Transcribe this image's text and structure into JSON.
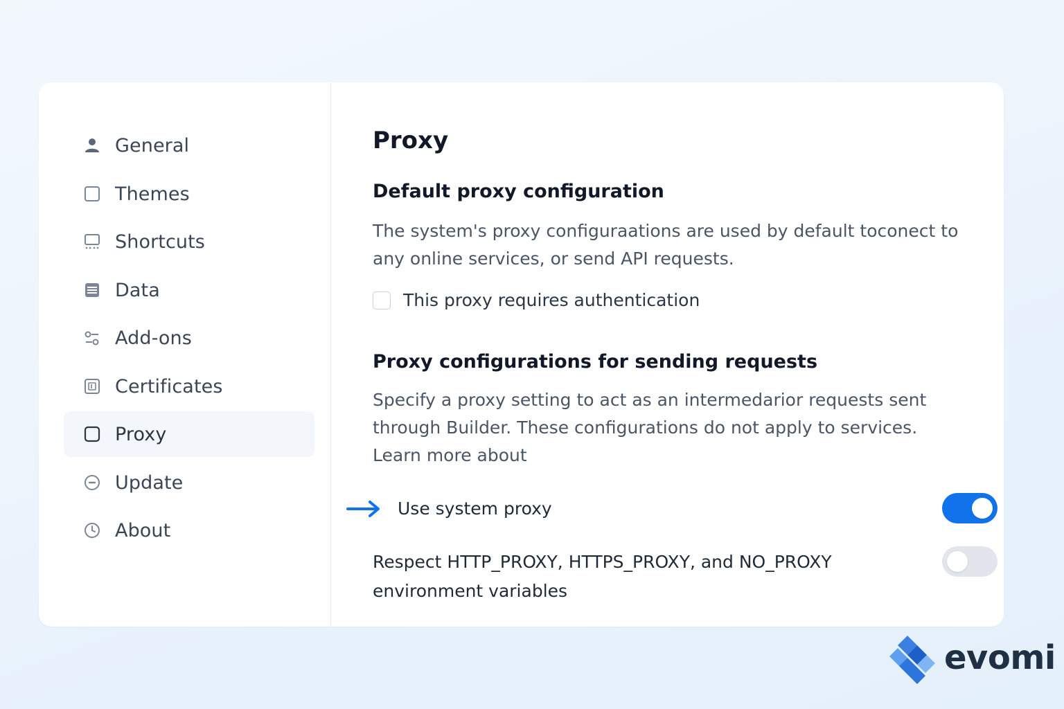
{
  "sidebar": {
    "items": [
      {
        "label": "General",
        "icon": "person-icon",
        "active": false
      },
      {
        "label": "Themes",
        "icon": "square-icon",
        "active": false
      },
      {
        "label": "Shortcuts",
        "icon": "keyboard-icon",
        "active": false
      },
      {
        "label": "Data",
        "icon": "database-icon",
        "active": false
      },
      {
        "label": "Add-ons",
        "icon": "addons-icon",
        "active": false
      },
      {
        "label": "Certificates",
        "icon": "certificate-icon",
        "active": false
      },
      {
        "label": "Proxy",
        "icon": "square-icon",
        "active": true
      },
      {
        "label": "Update",
        "icon": "update-icon",
        "active": false
      },
      {
        "label": "About",
        "icon": "clock-icon",
        "active": false
      }
    ]
  },
  "main": {
    "title": "Proxy",
    "default_section": {
      "title": "Default proxy configuration",
      "description_line1": "The system's proxy configuraations are used by default toconect to",
      "description_line2": "any online services, or send API requests.",
      "auth_checkbox": {
        "label": "This proxy requires authentication",
        "checked": false
      }
    },
    "requests_section": {
      "title": "Proxy configurations for sending requests",
      "description_line1": "Specify a proxy setting to act as an intermedarior requests sent",
      "description_line2": "through Builder. These configurations do not apply to services.",
      "description_line3": "Learn more about"
    },
    "toggles": {
      "system_proxy": {
        "label": "Use system proxy",
        "on": true
      },
      "env_vars": {
        "label_line1": "Respect HTTP_PROXY, HTTPS_PROXY, and NO_PROXY",
        "label_line2": "environment variables",
        "on": false
      }
    }
  },
  "brand": {
    "name": "evomi"
  },
  "colors": {
    "accent": "#1173ec",
    "toggle_off": "#e2e6ec",
    "active_item_bg": "#f3f7fb"
  }
}
